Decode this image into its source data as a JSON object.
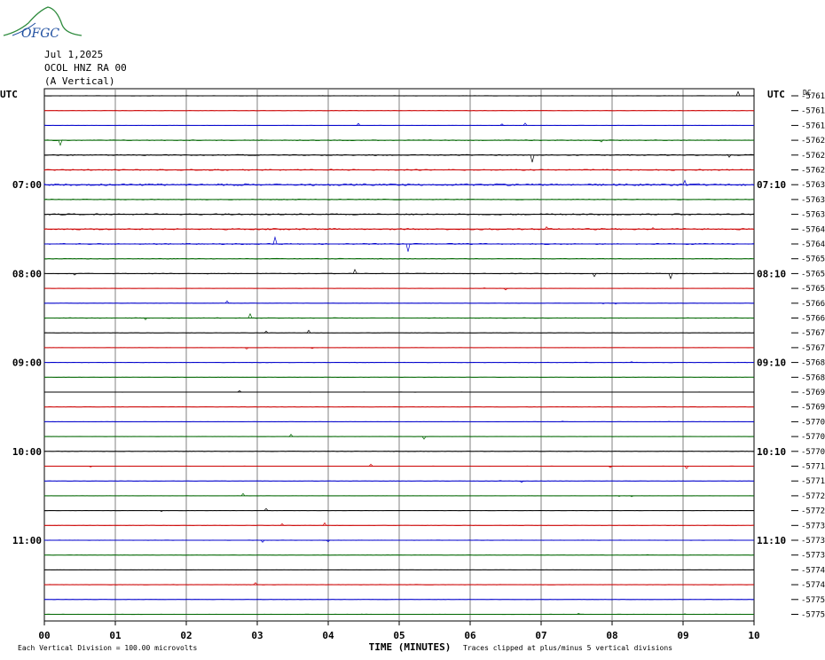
{
  "header": {
    "logo_text": "OFGC",
    "date": "Jul 1,2025",
    "station": "OCOL HNZ RA 00",
    "component": "(A Vertical)"
  },
  "axis_labels": {
    "utc_left": "UTC",
    "utc_right": "UTC",
    "dc_label": "DC",
    "xlabel": "TIME (MINUTES)",
    "footer_left": "Each Vertical Division =  100.00 microvolts",
    "footer_right": "Traces clipped at plus/minus 5 vertical divisions"
  },
  "chart_data": {
    "type": "line",
    "xlabel": "TIME (MINUTES)",
    "x_ticks": [
      "00",
      "01",
      "02",
      "03",
      "04",
      "05",
      "06",
      "07",
      "08",
      "09",
      "10"
    ],
    "xlim": [
      0,
      10
    ],
    "trace_count": 36,
    "trace_minutes": 10,
    "trace_color_cycle": [
      "#000000",
      "#cc0000",
      "#0000cc",
      "#006600"
    ],
    "left_time_labels": [
      {
        "trace": 6,
        "label": "07:00"
      },
      {
        "trace": 12,
        "label": "08:00"
      },
      {
        "trace": 18,
        "label": "09:00"
      },
      {
        "trace": 24,
        "label": "10:00"
      },
      {
        "trace": 30,
        "label": "11:00"
      }
    ],
    "right_time_labels": [
      {
        "trace": 6,
        "label": "07:10"
      },
      {
        "trace": 12,
        "label": "08:10"
      },
      {
        "trace": 18,
        "label": "09:10"
      },
      {
        "trace": 24,
        "label": "10:10"
      },
      {
        "trace": 30,
        "label": "11:10"
      }
    ],
    "dc_offsets": [
      "-57613",
      "-57616",
      "-57619",
      "-57623",
      "-57626",
      "-57629",
      "-57631",
      "-57634",
      "-57635",
      "-57645",
      "-57647",
      "-57650",
      "-57657",
      "-57659",
      "-57663",
      "-57666",
      "-57671",
      "-57677",
      "-57682",
      "-57687",
      "-57692",
      "-57696",
      "-57701",
      "-57707",
      "-57709",
      "-57715",
      "-57717",
      "-57721",
      "-57723",
      "-57730",
      "-57734",
      "-57739",
      "-57744",
      "-57749",
      "-57753",
      "-57758"
    ],
    "noise_level": [
      0.3,
      0.2,
      0.2,
      0.5,
      0.6,
      0.6,
      1.0,
      0.5,
      0.7,
      0.8,
      0.6,
      0.4,
      0.4,
      0.2,
      0.2,
      0.4,
      0.2,
      0.2,
      0.3,
      0.2,
      0.2,
      0.2,
      0.2,
      0.2,
      0.3,
      0.2,
      0.2,
      0.2,
      0.2,
      0.2,
      0.3,
      0.2,
      0.2,
      0.3,
      0.2,
      0.3
    ]
  }
}
